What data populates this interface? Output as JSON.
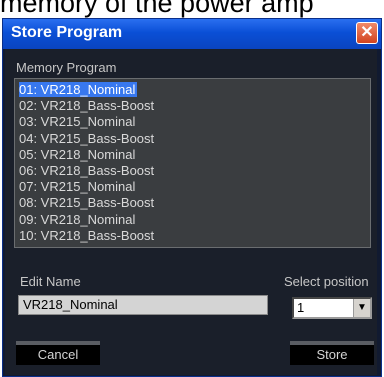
{
  "caption": "memory of the power amp",
  "window": {
    "title": "Store Program",
    "close_symbol": "✕"
  },
  "memory_program": {
    "label": "Memory Program",
    "items": [
      "01: VR218_Nominal",
      "02: VR218_Bass-Boost",
      "03: VR215_Nominal",
      "04: VR215_Bass-Boost",
      "05: VR218_Nominal",
      "06: VR218_Bass-Boost",
      "07: VR215_Nominal",
      "08: VR215_Bass-Boost",
      "09: VR218_Nominal",
      "10: VR218_Bass-Boost"
    ],
    "selected_index": 0
  },
  "edit_name": {
    "label": "Edit Name",
    "value": "VR218_Nominal"
  },
  "select_position": {
    "label": "Select position",
    "value": "1",
    "arrow": "▼"
  },
  "buttons": {
    "cancel": "Cancel",
    "store": "Store"
  },
  "colors": {
    "titlebar": "#0a4fd6",
    "selection": "#3878ef",
    "background": "#1a1f2a"
  }
}
